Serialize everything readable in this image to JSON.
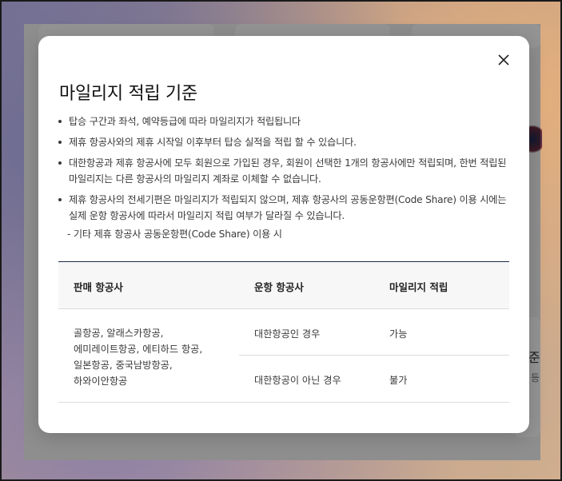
{
  "background": {
    "partial_text_1": "준",
    "partial_text_2": "등"
  },
  "modal": {
    "title": "마일리지 적립 기준",
    "close_label": "닫기",
    "bullets": [
      "탑승 구간과 좌석, 예약등급에 따라 마일리지가 적립됩니다",
      "제휴 항공사와의 제휴 시작일 이후부터  탑승 실적을 적립 할 수 있습니다.",
      "대한항공과 제휴 항공사에 모두 회원으로 가입된 경우, 회원이 선택한 1개의 항공사에만 적립되며, 한번 적립된 마일리지는 다른 항공사의 마일리지 계좌로 이체할 수 없습니다.",
      "제휴 항공사의 전세기편은 마일리지가 적립되지 않으며, 제휴 항공사의 공동운항편(Code Share) 이용 시에는 실제 운항 항공사에 따라서 마일리지 적립 여부가 달라질 수 있습니다."
    ],
    "sub_note": "-  기타 제휴 항공사 공동운항편(Code Share) 이용 시",
    "table": {
      "headers": [
        "판매 항공사",
        "운항 항공사",
        "마일리지 적립"
      ],
      "seller_lines": [
        "골항공, 알래스카항공,",
        "에미레이트항공, 에티하드 항공,",
        "일본항공, 중국남방항공,",
        "하와이안항공"
      ],
      "rows": [
        {
          "operator": "대한항공인 경우",
          "mileage": "가능"
        },
        {
          "operator": "대한항공이 아닌 경우",
          "mileage": "불가"
        }
      ]
    }
  },
  "colors": {
    "table_top_border": "#1b2a4a",
    "header_bg": "#f7f7f7",
    "overlay": "rgba(0,0,0,0.42)"
  }
}
